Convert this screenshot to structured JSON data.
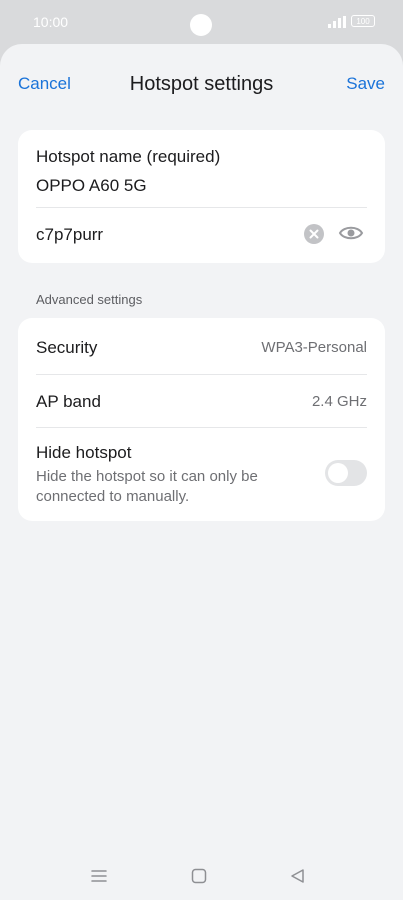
{
  "status_bar": {
    "time": "10:00",
    "battery": "100",
    "icons": [
      "signal-icon",
      "battery-icon"
    ]
  },
  "header": {
    "cancel_label": "Cancel",
    "title": "Hotspot settings",
    "save_label": "Save"
  },
  "hotspot": {
    "name_label": "Hotspot name (required)",
    "name_value": "OPPO A60 5G",
    "password_value": "c7p7purr",
    "icons": [
      "clear-icon",
      "eye-icon"
    ]
  },
  "advanced": {
    "section_label": "Advanced settings",
    "security": {
      "label": "Security",
      "value": "WPA3-Personal"
    },
    "ap_band": {
      "label": "AP band",
      "value": "2.4 GHz"
    },
    "hide_hotspot": {
      "label": "Hide hotspot",
      "description": "Hide the hotspot so it can only be connected to manually.",
      "enabled": false
    }
  },
  "colors": {
    "accent": "#1a73d9",
    "background": "#f2f3f5",
    "card": "#ffffff",
    "toggle_off": "#e3e4e6"
  },
  "nav_bar": {
    "icons": [
      "menu-icon",
      "home-icon",
      "back-icon"
    ]
  }
}
